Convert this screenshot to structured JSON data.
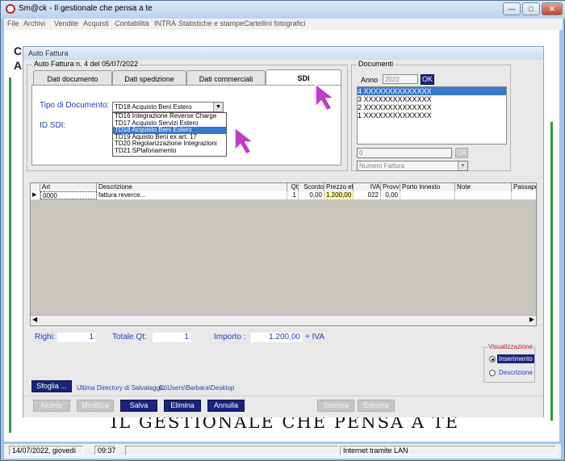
{
  "window": {
    "title": "Sm@ck - Il gestionale che pensa a te",
    "min_glyph": "—",
    "max_glyph": "□",
    "close_glyph": "✕"
  },
  "menubar": {
    "items": [
      "File",
      "Archivi",
      "Vendite",
      "Acquisti",
      "Contabilità",
      "INTRA",
      "Statistiche e stampe",
      "Cartellini fotografici"
    ]
  },
  "background": {
    "slogan": "IL GESTIONALE CHE PENSA A TE",
    "logo_a": "C",
    "logo_b": "A"
  },
  "dialog": {
    "title": "Auto Fattura",
    "group_title": "Auto Fattura n. 4 del 05/07/2022",
    "tabs": [
      {
        "label": "Dati documento"
      },
      {
        "label": "Dati spedizione"
      },
      {
        "label": "Dati commerciali"
      },
      {
        "label": "SDI"
      }
    ],
    "sdi": {
      "tipo_label": "Tipo di Documento:",
      "tipo_value": "TD18 Acquisto Beni Estero",
      "idsdi_label": "ID SDI:",
      "options": [
        "TD16 Integrazione Reverse Charge",
        "TD17 Acquisto Servizi Estero",
        "TD18 Acquisto Beni Estero",
        "TD19 Aquisto Beni ex art. 17",
        "TD20 Regolarizzazione Integrazioni",
        "TD21 SPlafonamento"
      ]
    },
    "documenti": {
      "title": "Documenti",
      "anno_label": "Anno",
      "anno_value": "2022",
      "ok": "OK",
      "rows": [
        {
          "num": "4",
          "text": "XXXXXXXXXXXXXX"
        },
        {
          "num": "3",
          "text": "XXXXXXXXXXXXXX"
        },
        {
          "num": "2",
          "text": "XXXXXXXXXXXXXX"
        },
        {
          "num": "1",
          "text": "XXXXXXXXXXXXXX"
        }
      ],
      "number_input": "0",
      "ok2": "OK",
      "combo_value": "Numero Fattura"
    },
    "grid": {
      "headers": [
        "Art",
        "Descrizione",
        "Qt",
        "Sconto",
        "Prezzo eff",
        "IVA",
        "Provv",
        "Porto innesto",
        "Note",
        "Passapor"
      ],
      "row": {
        "art": "0000",
        "descrizione": "fattura reverce...",
        "qt": "1",
        "sconto": "0,00",
        "prezzo": "1.200,00",
        "iva": "022",
        "provv": "0,00",
        "porto": "",
        "note": "",
        "pass": ""
      }
    },
    "totals": {
      "righi_label": "Righi:",
      "righi": "1",
      "totqt_label": "Totale Qt:",
      "totqt": "1",
      "importo_label": "Importo :",
      "importo": "1.200,00",
      "iva_suffix": "+ IVA"
    },
    "visualizzazione": {
      "title": "Visualizzazione",
      "inserimento": "Inserimento",
      "descrizione": "Descrizione"
    },
    "sfoglia": "Sfoglia ...",
    "ultima_dir_label": "Ultima Directory di Salvataggio:",
    "ultima_dir_path": "C:\\Users\\Barbara\\Desktop",
    "buttons": {
      "nuovo": "Nuovo",
      "modifica": "Modifica",
      "salva": "Salva",
      "elimina": "Elimina",
      "annulla": "Annulla",
      "stampa": "Stampa",
      "esporta": "Esporta"
    }
  },
  "statusbar": {
    "date": "14/07/2022, giovedì",
    "time": "09:37",
    "connection": "Internet tramite LAN"
  },
  "colors": {
    "accent": "#1a237e",
    "label_blue": "#1f3fb8",
    "selection": "#3477d4",
    "cursor": "#c03cc8"
  }
}
